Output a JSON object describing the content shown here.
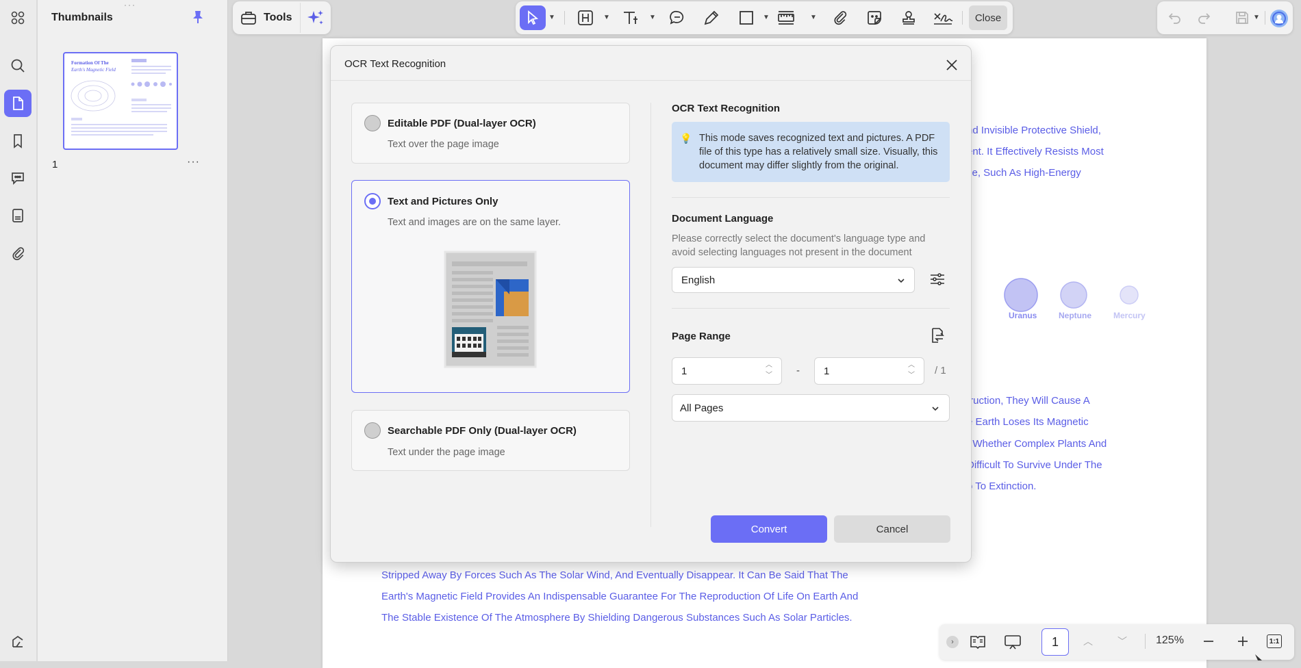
{
  "panel": {
    "title": "Thumbnails",
    "page_number": "1",
    "thumbnail_title_1": "Formation Of The",
    "thumbnail_title_2": "Earth's Magnetic Field"
  },
  "toolbar": {
    "tools_label": "Tools",
    "close_label": "Close"
  },
  "document": {
    "lines_right_top": [
      "nd Invisible Protective Shield,",
      "ent. It Effectively Resists Most",
      "se, Such As High-Energy"
    ],
    "planet_labels": [
      "Uranus",
      "Neptune",
      "Mercury"
    ],
    "lines_right_mid": [
      "truction, They Will Cause A",
      "e Earth Loses Its Magnetic",
      ", Whether Complex Plants And",
      "Difficult To Survive Under The",
      "o To Extinction."
    ],
    "lines_bottom": [
      "Stripped Away By Forces Such As The Solar Wind, And Eventually Disappear. It Can Be Said That The",
      "Earth's Magnetic Field Provides An Indispensable Guarantee For The Reproduction Of Life On Earth And",
      "The Stable Existence Of The Atmosphere By Shielding Dangerous Substances Such As Solar Particles."
    ]
  },
  "dialog": {
    "title": "OCR Text Recognition",
    "options": [
      {
        "title": "Editable PDF (Dual-layer OCR)",
        "subtitle": "Text over the page image",
        "selected": false
      },
      {
        "title": "Text and Pictures Only",
        "subtitle": "Text and images are on the same layer.",
        "selected": true
      },
      {
        "title": "Searchable PDF Only (Dual-layer OCR)",
        "subtitle": "Text under the page image",
        "selected": false
      }
    ],
    "ocr_section_title": "OCR Text Recognition",
    "info_text": "This mode saves recognized text and pictures. A PDF file of this type has a relatively small size. Visually, this document may differ slightly from the original.",
    "language_title": "Document Language",
    "language_desc": "Please correctly select the document's language type and avoid selecting languages not present in the document",
    "language_value": "English",
    "page_range_title": "Page Range",
    "range_from": "1",
    "range_separator": "-",
    "range_to": "1",
    "range_total": "/ 1",
    "range_mode": "All Pages",
    "convert_label": "Convert",
    "cancel_label": "Cancel"
  },
  "bottombar": {
    "page_input": "1",
    "zoom": "125%",
    "fit_label": "1:1"
  },
  "colors": {
    "accent": "#6b6ef5",
    "doc_text": "#5a5de6",
    "info_bg": "#cfe0f5"
  }
}
